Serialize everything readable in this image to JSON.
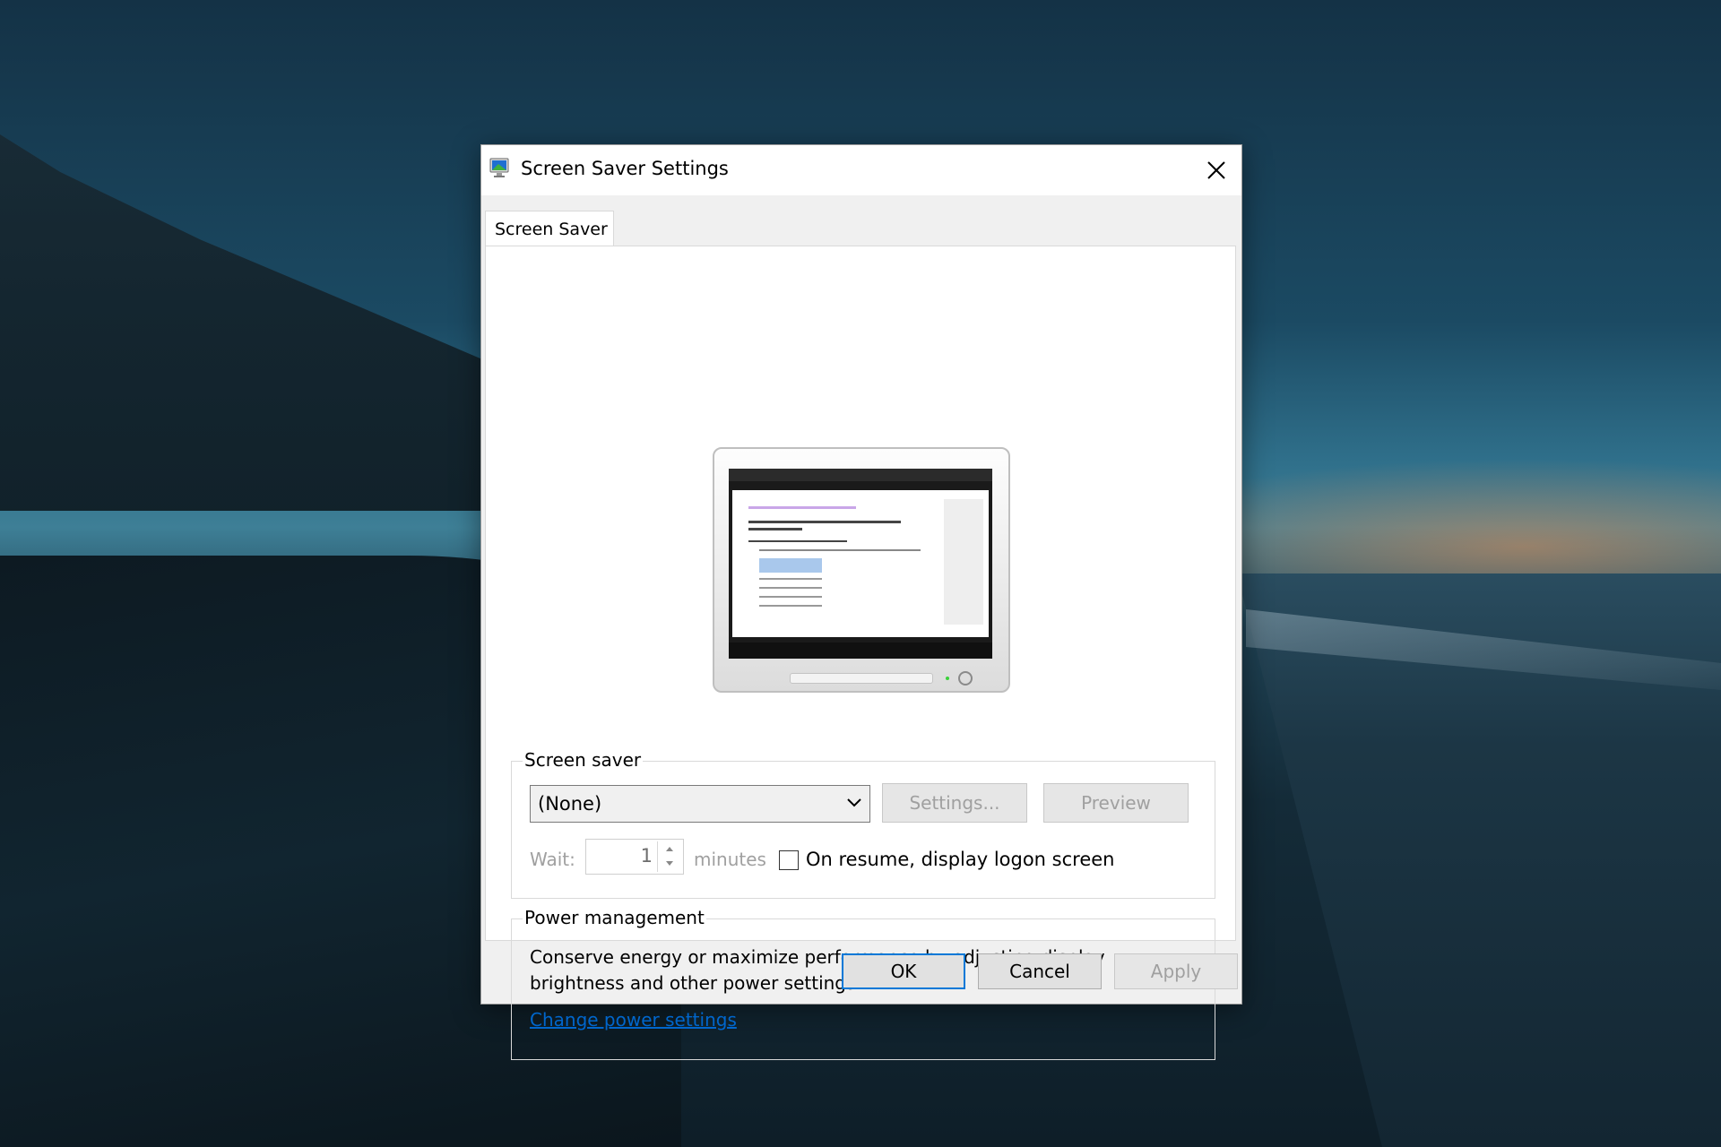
{
  "window": {
    "title": "Screen Saver Settings",
    "close_icon": "close-icon"
  },
  "tabs": [
    {
      "label": "Screen Saver",
      "active": true
    }
  ],
  "screen_saver": {
    "group_label": "Screen saver",
    "selected": "(None)",
    "settings_label": "Settings...",
    "preview_label": "Preview",
    "wait_label": "Wait:",
    "wait_value": "1",
    "minutes_label": "minutes",
    "logon_checkbox_label": "On resume, display logon screen",
    "logon_checked": false
  },
  "power": {
    "group_label": "Power management",
    "description": "Conserve energy or maximize performance by adjusting display brightness and other power settings.",
    "link_label": "Change power settings"
  },
  "footer": {
    "ok_label": "OK",
    "cancel_label": "Cancel",
    "apply_label": "Apply"
  },
  "colors": {
    "link": "#0066cc",
    "focus": "#0078d7"
  }
}
